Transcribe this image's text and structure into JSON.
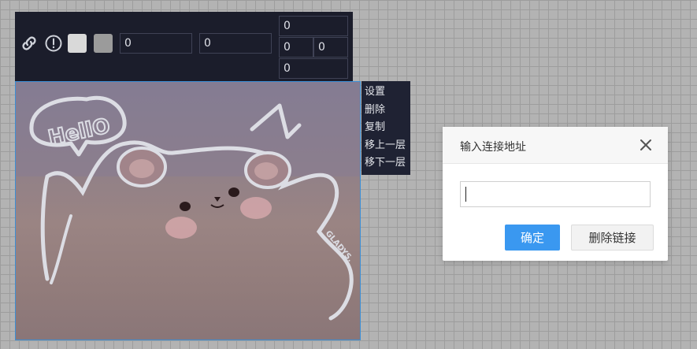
{
  "toolbar": {
    "link_icon": "link-icon",
    "info_icon": "info-circle-icon",
    "swatch_light_color": "#d9d9d9",
    "swatch_gray_color": "#9b9b9b",
    "input_1": "0",
    "input_2": "0",
    "padding_top": "0",
    "padding_left": "0",
    "padding_right": "0",
    "padding_bottom": "0"
  },
  "image": {
    "bubble_text": "HellO",
    "signature": "GLADYS."
  },
  "context_menu": {
    "items": [
      "设置",
      "删除",
      "复制",
      "移上一层",
      "移下一层"
    ]
  },
  "dialog": {
    "title": "输入连接地址",
    "input_value": "",
    "confirm_label": "确定",
    "delete_label": "删除链接"
  }
}
